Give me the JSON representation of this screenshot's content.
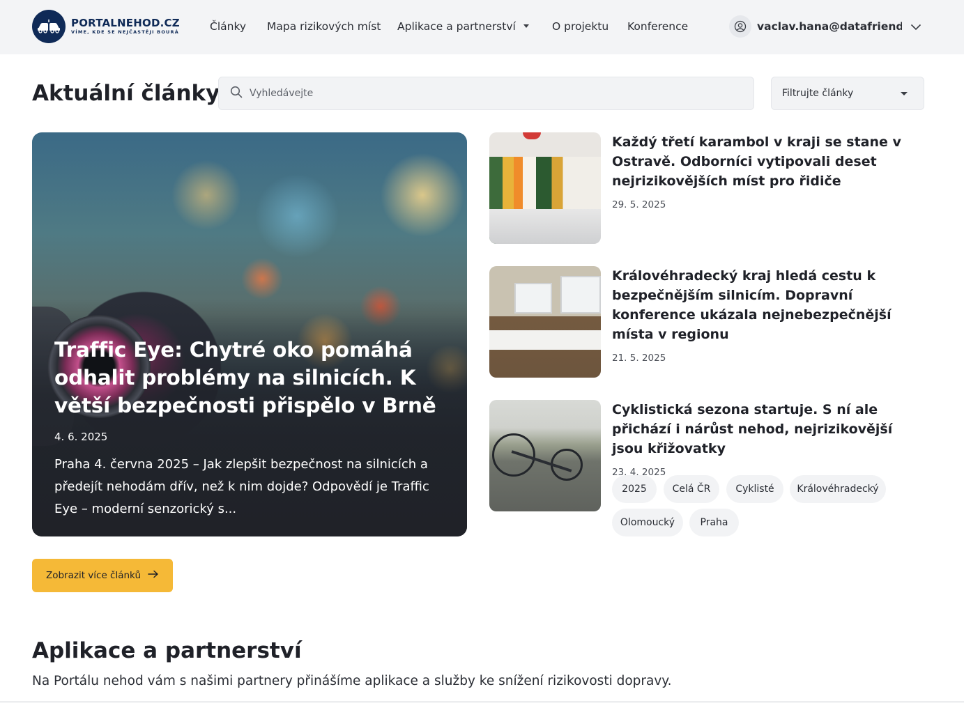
{
  "header": {
    "logo_name": "PORTALNEHOD.CZ",
    "logo_tagline": "VÍME, KDE SE NEJČASTĚJI BOURÁ",
    "nav": [
      {
        "label": "Články"
      },
      {
        "label": "Mapa rizikových míst"
      },
      {
        "label": "Aplikace a partnerství"
      },
      {
        "label": "O projektu"
      },
      {
        "label": "Konference"
      }
    ],
    "user_email": "vaclav.hana@datafriends..."
  },
  "articles": {
    "title": "Aktuální články",
    "search_placeholder": "Vyhledávejte",
    "filter_label": "Filtrujte články",
    "featured": {
      "title": "Traffic Eye: Chytré oko pomáhá odhalit problémy na silnicích. K větší bezpečnosti přispělo v Brně",
      "date": "4. 6. 2025",
      "excerpt": "Praha 4. června 2025 – Jak zlepšit bezpečnost na silnicích a předejít nehodám dřív, než k nim dojde? Odpovědí je Traffic Eye – moderní senzorický s..."
    },
    "list": [
      {
        "title": "Každý třetí karambol v kraji se stane v Ostravě. Odborníci vytipovali deset nejrizikovějších míst pro řidiče",
        "date": "29. 5. 2025"
      },
      {
        "title": "Královéhradecký kraj hledá cestu k bezpečnějším silnicím. Dopravní konference ukázala nejnebezpečnější místa v regionu",
        "date": "21. 5. 2025"
      },
      {
        "title": "Cyklistická sezona startuje. S ní ale přichází i nárůst nehod, nejrizikovější jsou křižovatky",
        "date": "23. 4. 2025"
      }
    ],
    "tags": [
      "2025",
      "Celá ČR",
      "Cyklisté",
      "Královéhradecký",
      "Olomoucký",
      "Praha"
    ],
    "more_button": "Zobrazit více článků"
  },
  "apps": {
    "title": "Aplikace a partnerství",
    "subtitle": "Na Portálu nehod vám s našimi partnery přinášíme aplikace a služby ke snížení rizikovosti dopravy."
  },
  "colors": {
    "brand_navy": "#0f2a57",
    "accent_yellow": "#f5b937",
    "header_bg": "#f3f4f6"
  }
}
